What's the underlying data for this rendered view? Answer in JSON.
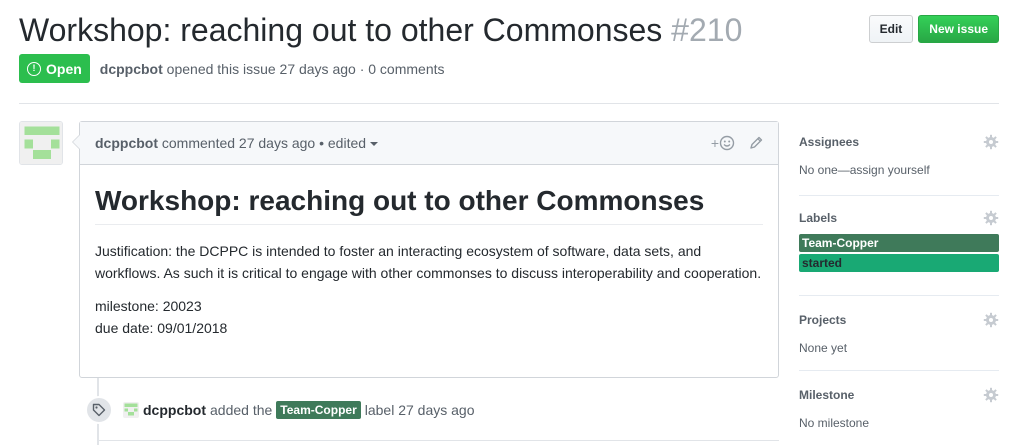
{
  "issue": {
    "title": "Workshop: reaching out to other Commonses",
    "number": "#210",
    "state": "Open",
    "author": "dcppcbot",
    "meta": "opened this issue 27 days ago · 0 comments"
  },
  "actions": {
    "edit_label": "Edit",
    "new_issue_label": "New issue"
  },
  "comment": {
    "author": "dcppcbot",
    "meta": "commented 27 days ago • edited",
    "reaction_plus": "+",
    "heading": "Workshop: reaching out to other Commonses",
    "justification": "Justification: the DCPPC is intended to foster an interacting ecosystem of software, data sets, and workflows. As such it is critical to engage with other commonses to discuss interoperability and cooperation.",
    "milestone_line": "milestone: 20023",
    "due_line": "due date: 09/01/2018"
  },
  "event": {
    "author": "dcppcbot",
    "text_before": "added the",
    "label": "Team-Copper",
    "text_after": "label 27 days ago"
  },
  "sidebar": {
    "assignees_title": "Assignees",
    "assignees_value": "No one—assign yourself",
    "labels_title": "Labels",
    "labels": [
      {
        "name": "Team-Copper",
        "color": "#3f7a5a"
      },
      {
        "name": "started",
        "color": "#19a974"
      }
    ],
    "projects_title": "Projects",
    "projects_value": "None yet",
    "milestone_title": "Milestone",
    "milestone_value": "No milestone"
  },
  "colors": {
    "open_green": "#2cbe4e",
    "new_issue_green": "#28a745",
    "team_copper": "#3f7a5a",
    "started": "#19a974"
  },
  "icons": {
    "state": "issue-opened-icon",
    "reaction": "smiley-icon",
    "edit": "pencil-icon",
    "gear": "gear-icon",
    "event": "tag-icon"
  }
}
